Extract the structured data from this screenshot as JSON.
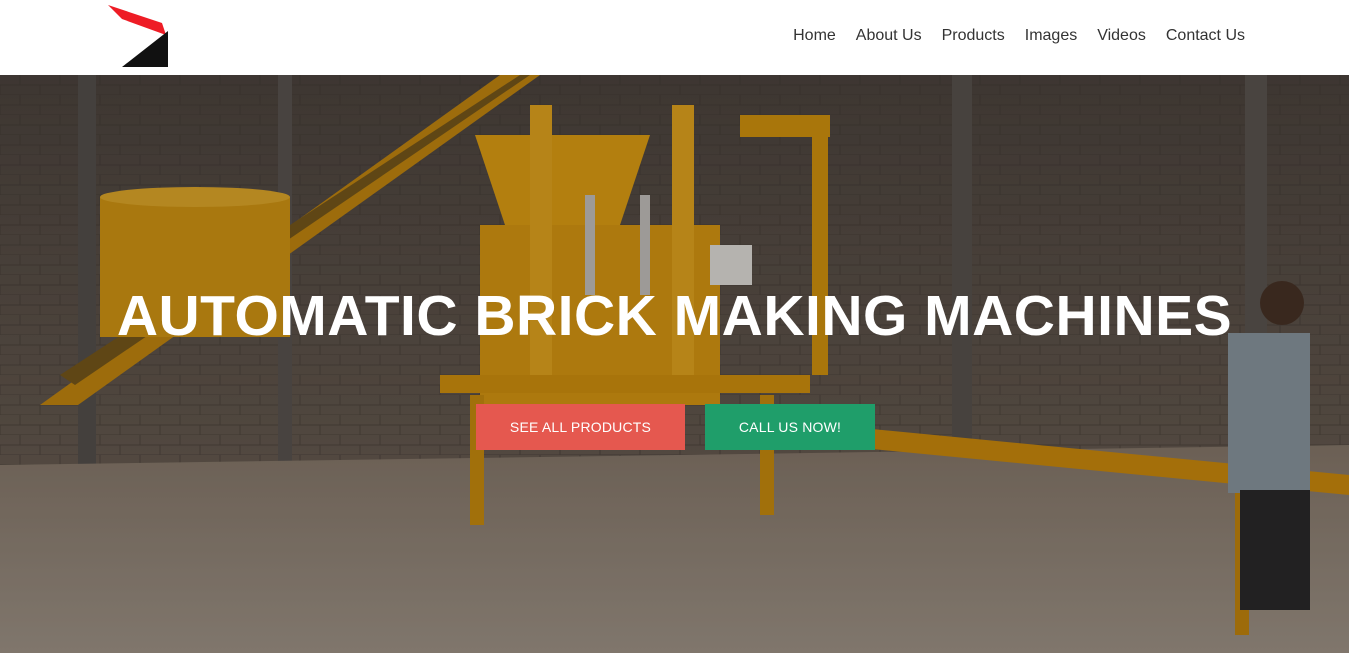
{
  "header": {
    "logo_name": "brand-logo",
    "nav": [
      {
        "label": "Home"
      },
      {
        "label": "About Us"
      },
      {
        "label": "Products"
      },
      {
        "label": "Images"
      },
      {
        "label": "Videos"
      },
      {
        "label": "Contact Us"
      }
    ]
  },
  "hero": {
    "title": "AUTOMATIC BRICK MAKING MACHINES",
    "buttons": {
      "products_label": "SEE ALL PRODUCTS",
      "call_label": "CALL US NOW!"
    },
    "image_subject": "yellow brick making machine with conveyor in workshop"
  },
  "colors": {
    "nav_text": "#333333",
    "button_products": "#e5584f",
    "button_call": "#1f9e6a",
    "logo_red": "#ee1c25",
    "logo_black": "#111111",
    "machine_yellow": "#e9a312"
  }
}
